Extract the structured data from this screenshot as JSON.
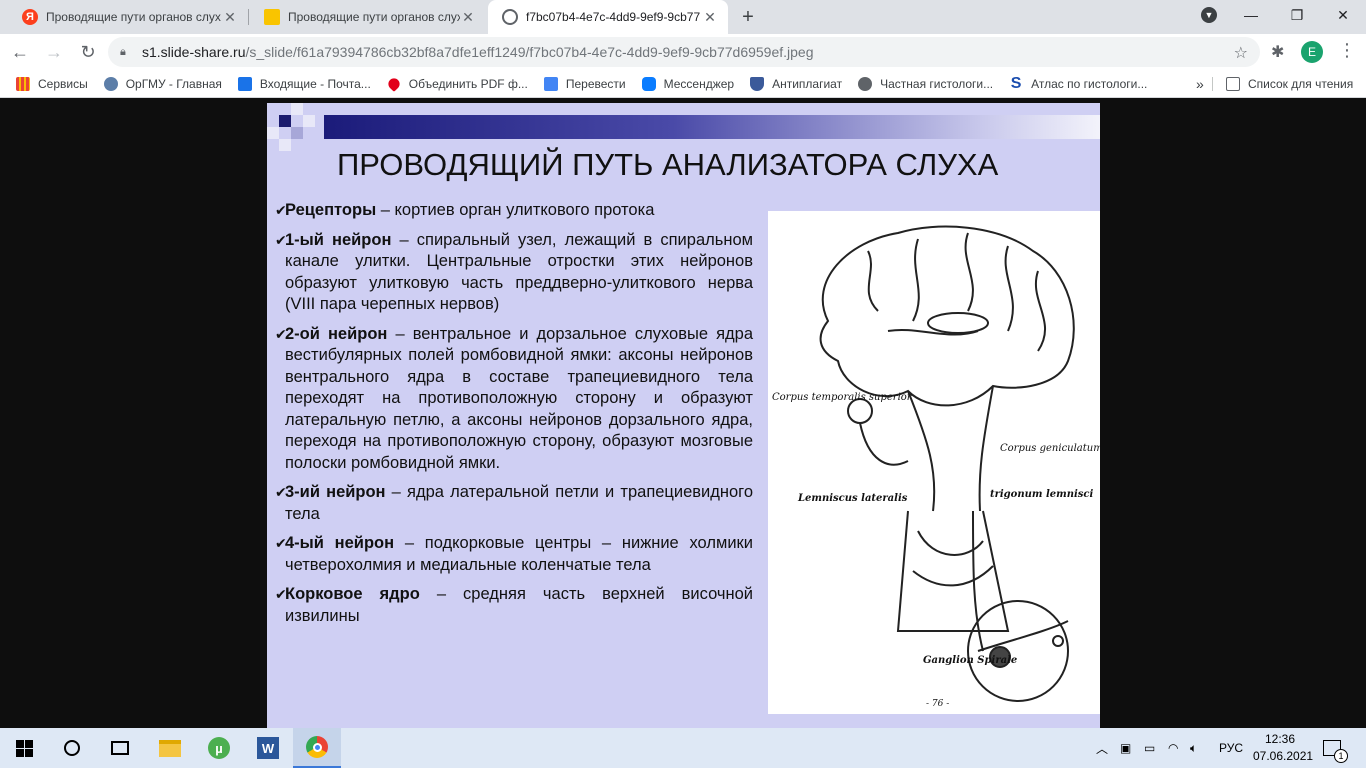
{
  "browser": {
    "tabs": [
      {
        "title": "Проводящие пути органов слух",
        "favicon_color": "#fc3f1d"
      },
      {
        "title": "Проводящие пути органов слух",
        "favicon_color": "#f9c400"
      },
      {
        "title": "f7bc07b4-4e7c-4dd9-9ef9-9cb77",
        "favicon_color": "#5f6368",
        "active": true
      }
    ],
    "new_tab": "+",
    "url_domain": "s1.slide-share.ru",
    "url_path": "/s_slide/f61a79394786cb32bf8a7dfe1eff1249/f7bc07b4-4e7c-4dd9-9ef9-9cb77d6959ef.jpeg",
    "avatar_letter": "E",
    "bookmarks": [
      {
        "label": "Сервисы",
        "color": "#ea4335"
      },
      {
        "label": "ОрГМУ - Главная",
        "color": "#5c7ea8"
      },
      {
        "label": "Входящие - Почта...",
        "color": "#1a73e8"
      },
      {
        "label": "Объединить PDF ф...",
        "color": "#e2001a"
      },
      {
        "label": "Перевести",
        "color": "#4285f4"
      },
      {
        "label": "Мессенджер",
        "color": "#0a7cff"
      },
      {
        "label": "Антиплагиат",
        "color": "#3b5a9a"
      },
      {
        "label": "Частная гистологи...",
        "color": "#5f6368"
      },
      {
        "label": "Атлас по гистологи...",
        "color": "#1a4dae"
      }
    ],
    "more_bookmarks": "»",
    "reading_list": "Список для чтения"
  },
  "slide": {
    "title": "ПРОВОДЯЩИЙ ПУТЬ АНАЛИЗАТОРА СЛУХА",
    "bullets": [
      {
        "head": "Рецепторы",
        "text": " – кортиев орган улиткового протока"
      },
      {
        "head": "1-ый нейрон",
        "text": " – спиральный узел, лежащий в спиральном канале улитки. Центральные отростки этих нейронов образуют улитковую часть преддверно-улиткового нерва (VIII пара черепных нервов)"
      },
      {
        "head": "2-ой нейрон",
        "text": " – вентральное и дорзальное слуховые ядра вестибулярных полей ромбовидной ямки: аксоны нейронов вентрального ядра в составе трапециевидного тела переходят на противоположную сторону и образуют латеральную петлю, а аксоны нейронов дорзального ядра, переходя на противоположную сторону, образуют мозговые полоски ромбовидной ямки."
      },
      {
        "head": "3-ий нейрон",
        "text": " – ядра латеральной петли и трапециевидного тела"
      },
      {
        "head": "4-ый нейрон",
        "text": " – подкорковые центры – нижние холмики четверохолмия и медиальные коленчатые тела"
      },
      {
        "head": "Корковое ядро",
        "text": " – средняя часть верхней височной извилины"
      }
    ],
    "figure_labels": {
      "corpus_temporalis": "Corpus temporalis superior",
      "corpus_geniculatum": "Corpus geniculatum mediale",
      "lemniscus": "Lemniscus lateralis",
      "trigonum": "trigonum lemnisci",
      "ganglion": "Ganglion Spirale",
      "page": "- 76 -"
    }
  },
  "taskbar": {
    "language": "РУС",
    "time": "12:36",
    "date": "07.06.2021",
    "notifications": "1"
  }
}
